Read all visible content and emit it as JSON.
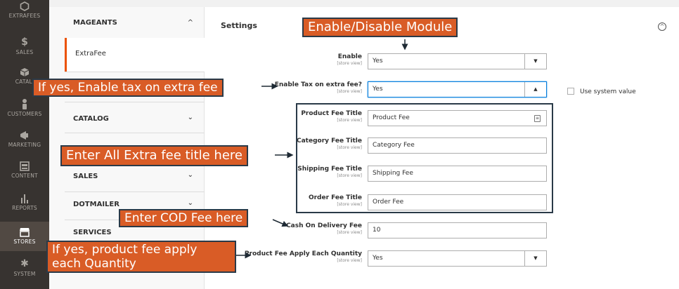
{
  "admin_nav": {
    "items": [
      {
        "label": "EXTRAFEES",
        "icon": "hexagon-icon"
      },
      {
        "label": "SALES",
        "icon": "dollar-icon"
      },
      {
        "label": "CATALI",
        "icon": "cube-icon"
      },
      {
        "label": "CUSTOMERS",
        "icon": "person-icon"
      },
      {
        "label": "MARKETING",
        "icon": "megaphone-icon"
      },
      {
        "label": "CONTENT",
        "icon": "layout-icon"
      },
      {
        "label": "REPORTS",
        "icon": "bar-chart-icon"
      },
      {
        "label": "STORES",
        "icon": "store-icon",
        "active": true
      },
      {
        "label": "SYSTEM",
        "icon": "gear-icon"
      }
    ]
  },
  "config_sidebar": {
    "sections": [
      {
        "label": "MAGEANTS",
        "chevron": "^"
      },
      {
        "label": "CATALOG",
        "chevron": "⌄"
      },
      {
        "label": "SALES",
        "chevron": "⌄"
      },
      {
        "label": "DOTMAILER",
        "chevron": "⌄"
      },
      {
        "label": "SERVICES",
        "chevron": ""
      }
    ],
    "active_item": "ExtraFee"
  },
  "settings": {
    "title": "Settings",
    "scope": "[store view]",
    "enable": {
      "label": "Enable",
      "value": "Yes"
    },
    "enable_tax": {
      "label": "Enable Tax on extra fee?",
      "value": "Yes",
      "use_system_value": "Use system value"
    },
    "product_fee_title": {
      "label": "Product Fee Title",
      "value": "Product Fee"
    },
    "category_fee_title": {
      "label": "Category Fee Title",
      "value": "Category Fee"
    },
    "shipping_fee_title": {
      "label": "Shipping Fee Title",
      "value": "Shipping Fee"
    },
    "order_fee_title": {
      "label": "Order Fee Title",
      "value": "Order Fee"
    },
    "cod_fee": {
      "label": "Cash On Delivery Fee",
      "value": "10"
    },
    "apply_each_qty": {
      "label": "Product Fee Apply Each Quantity",
      "value": "Yes"
    }
  },
  "callouts": {
    "enable_module": "Enable/Disable Module",
    "enable_tax": "If yes, Enable tax on extra fee",
    "extra_fee_titles": "Enter All Extra fee title here",
    "cod_fee": "Enter COD Fee here",
    "each_qty_line1": "If yes, product fee apply",
    "each_qty_line2": "each Quantity"
  },
  "colors": {
    "nav_bg": "#373330",
    "accent": "#eb5202",
    "callout_bg": "#d95c26",
    "callout_border": "#2a3a48"
  }
}
